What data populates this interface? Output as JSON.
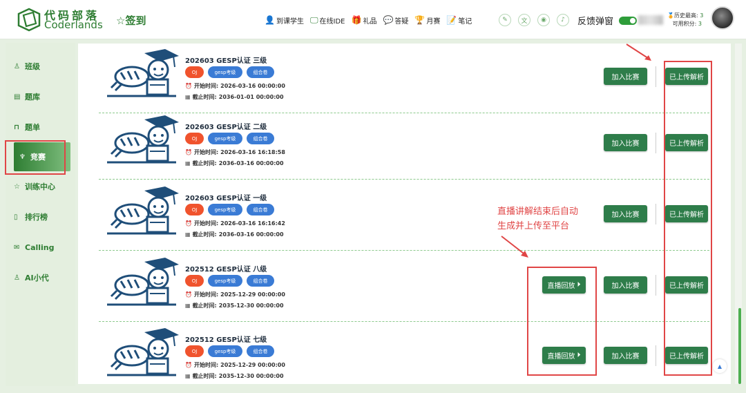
{
  "header": {
    "logo_cn": "代码部落",
    "logo_en": "Coderlands",
    "checkin": "签到",
    "nav": [
      {
        "label": "到课学生",
        "icon": "person-icon",
        "glyph": "👤"
      },
      {
        "label": "在线IDE",
        "icon": "monitor-icon",
        "glyph": "🖵"
      },
      {
        "label": "礼品",
        "icon": "gift-icon",
        "glyph": "🎁"
      },
      {
        "label": "答疑",
        "icon": "chat-icon",
        "glyph": "💬"
      },
      {
        "label": "月赛",
        "icon": "trophy-icon",
        "glyph": "🏆"
      },
      {
        "label": "笔记",
        "icon": "note-icon",
        "glyph": "📝"
      }
    ],
    "feedback": "反馈弹窗",
    "history_high_label": "历史最高:",
    "history_high_value": "3",
    "available_points_label": "可用积分:",
    "available_points_value": "3"
  },
  "sidebar": {
    "items": [
      {
        "label": "班级",
        "icon": "person-icon",
        "glyph": "♙"
      },
      {
        "label": "题库",
        "icon": "book-icon",
        "glyph": "▤"
      },
      {
        "label": "题单",
        "icon": "bookmark-icon",
        "glyph": "⊓"
      },
      {
        "label": "竞赛",
        "icon": "trophy-icon",
        "glyph": "♆"
      },
      {
        "label": "训练中心",
        "icon": "star-icon",
        "glyph": "☆"
      },
      {
        "label": "排行榜",
        "icon": "medal-icon",
        "glyph": "▯"
      },
      {
        "label": "Calling",
        "icon": "mail-icon",
        "glyph": "✉"
      },
      {
        "label": "AI小代",
        "icon": "robot-icon",
        "glyph": "♙"
      }
    ]
  },
  "contests": [
    {
      "title": "202603 GESP认证 三级",
      "start": "2026-03-16 00:00:00",
      "end": "2036-01-01 00:00:00",
      "replay": false
    },
    {
      "title": "202603 GESP认证 二级",
      "start": "2026-03-16 16:18:58",
      "end": "2036-03-16 00:00:00",
      "replay": false
    },
    {
      "title": "202603 GESP认证 一级",
      "start": "2026-03-16 16:16:42",
      "end": "2036-03-16 00:00:00",
      "replay": false
    },
    {
      "title": "202512 GESP认证 八级",
      "start": "2025-12-29 00:00:00",
      "end": "2035-12-30 00:00:00",
      "replay": true
    },
    {
      "title": "202512 GESP认证 七级",
      "start": "2025-12-29 00:00:00",
      "end": "2035-12-30 00:00:00",
      "replay": true
    }
  ],
  "labels": {
    "tag_oj": "OJ",
    "tag_gesp": "gesp考级",
    "tag_combo": "组合卷",
    "start_prefix": "开始时间:",
    "end_prefix": "截止时间:",
    "join_button": "加入比赛",
    "uploaded_button": "已上传解析",
    "replay_button": "直播回放"
  },
  "annotation": {
    "line1": "直播讲解结束后自动",
    "line2": "生成并上传至平台"
  },
  "colors": {
    "brand_green": "#2e7d32",
    "button_green": "#2e7d4a",
    "oj_tag": "#f0532d",
    "blue_tag": "#3a7bd5",
    "annotation_red": "#e04545"
  }
}
